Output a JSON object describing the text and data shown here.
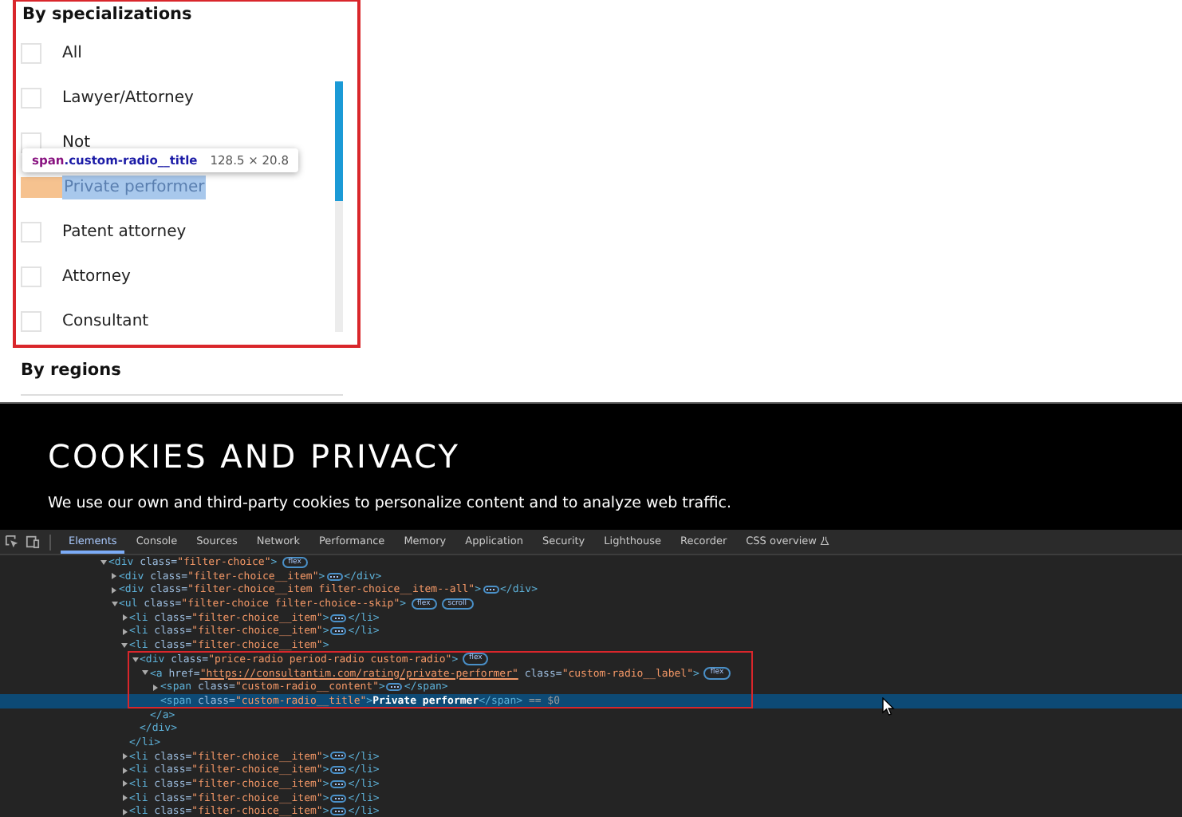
{
  "filter_panel": {
    "title": "By specializations",
    "items": [
      {
        "label": "All",
        "checked": false,
        "inspected": false
      },
      {
        "label": "Lawyer/Attorney",
        "checked": false,
        "inspected": false
      },
      {
        "label": "Not",
        "checked": false,
        "inspected": false
      },
      {
        "label": "Private performer",
        "checked": false,
        "inspected": true
      },
      {
        "label": "Patent attorney",
        "checked": false,
        "inspected": false
      },
      {
        "label": "Attorney",
        "checked": false,
        "inspected": false
      },
      {
        "label": "Consultant",
        "checked": false,
        "inspected": false
      }
    ],
    "inspect_tooltip": {
      "tag": "span",
      "selector": ".custom-radio__title",
      "size": "128.5 × 20.8"
    }
  },
  "regions_heading": "By regions",
  "cookie_banner": {
    "title": "COOKIES AND PRIVACY",
    "text": "We use our own and third-party cookies to personalize content and to analyze web traffic."
  },
  "devtools": {
    "tabs": [
      {
        "label": "Elements",
        "selected": true,
        "experimental": false
      },
      {
        "label": "Console",
        "selected": false,
        "experimental": false
      },
      {
        "label": "Sources",
        "selected": false,
        "experimental": false
      },
      {
        "label": "Network",
        "selected": false,
        "experimental": false
      },
      {
        "label": "Performance",
        "selected": false,
        "experimental": false
      },
      {
        "label": "Memory",
        "selected": false,
        "experimental": false
      },
      {
        "label": "Application",
        "selected": false,
        "experimental": false
      },
      {
        "label": "Security",
        "selected": false,
        "experimental": false
      },
      {
        "label": "Lighthouse",
        "selected": false,
        "experimental": false
      },
      {
        "label": "Recorder",
        "selected": false,
        "experimental": false
      },
      {
        "label": "CSS overview",
        "selected": false,
        "experimental": true
      }
    ],
    "dom_tree": [
      {
        "kind": "collapsible",
        "expanded": true,
        "selected": false,
        "segments": [
          {
            "text": "<div",
            "kind": "tag"
          },
          {
            "text": " class=",
            "kind": "attr"
          },
          {
            "text": "\"filter-choice\"",
            "kind": "value"
          },
          {
            "text": ">",
            "kind": "tag"
          },
          {
            "text": "flex",
            "kind": "badge"
          }
        ],
        "children": [
          {
            "kind": "collapsible",
            "expanded": false,
            "selected": false,
            "segments": [
              {
                "text": "<div",
                "kind": "tag"
              },
              {
                "text": " class=",
                "kind": "attr"
              },
              {
                "text": "\"filter-choice__item\"",
                "kind": "value"
              },
              {
                "text": ">",
                "kind": "tag"
              },
              {
                "kind": "ellipsis"
              },
              {
                "text": "</div>",
                "kind": "tag"
              }
            ]
          },
          {
            "kind": "collapsible",
            "expanded": false,
            "selected": false,
            "segments": [
              {
                "text": "<div",
                "kind": "tag"
              },
              {
                "text": " class=",
                "kind": "attr"
              },
              {
                "text": "\"filter-choice__item filter-choice__item--all\"",
                "kind": "value"
              },
              {
                "text": ">",
                "kind": "tag"
              },
              {
                "kind": "ellipsis"
              },
              {
                "text": "</div>",
                "kind": "tag"
              }
            ]
          },
          {
            "kind": "collapsible",
            "expanded": true,
            "selected": false,
            "segments": [
              {
                "text": "<ul",
                "kind": "tag"
              },
              {
                "text": " class=",
                "kind": "attr"
              },
              {
                "text": "\"filter-choice filter-choice--skip\"",
                "kind": "value"
              },
              {
                "text": ">",
                "kind": "tag"
              },
              {
                "text": "flex",
                "kind": "badge"
              },
              {
                "text": "scroll",
                "kind": "badge"
              }
            ],
            "children": [
              {
                "kind": "collapsible",
                "expanded": false,
                "selected": false,
                "segments": [
                  {
                    "text": "<li",
                    "kind": "tag"
                  },
                  {
                    "text": " class=",
                    "kind": "attr"
                  },
                  {
                    "text": "\"filter-choice__item\"",
                    "kind": "value"
                  },
                  {
                    "text": ">",
                    "kind": "tag"
                  },
                  {
                    "kind": "ellipsis"
                  },
                  {
                    "text": "</li>",
                    "kind": "tag"
                  }
                ]
              },
              {
                "kind": "collapsible",
                "expanded": false,
                "selected": false,
                "segments": [
                  {
                    "text": "<li",
                    "kind": "tag"
                  },
                  {
                    "text": " class=",
                    "kind": "attr"
                  },
                  {
                    "text": "\"filter-choice__item\"",
                    "kind": "value"
                  },
                  {
                    "text": ">",
                    "kind": "tag"
                  },
                  {
                    "kind": "ellipsis"
                  },
                  {
                    "text": "</li>",
                    "kind": "tag"
                  }
                ]
              },
              {
                "kind": "collapsible",
                "expanded": true,
                "selected": false,
                "segments": [
                  {
                    "text": "<li",
                    "kind": "tag"
                  },
                  {
                    "text": " class=",
                    "kind": "attr"
                  },
                  {
                    "text": "\"filter-choice__item\"",
                    "kind": "value"
                  },
                  {
                    "text": ">",
                    "kind": "tag"
                  }
                ],
                "closing": "</li>",
                "children": [
                  {
                    "kind": "collapsible",
                    "expanded": true,
                    "selected": false,
                    "segments": [
                      {
                        "text": "<div",
                        "kind": "tag"
                      },
                      {
                        "text": " class=",
                        "kind": "attr"
                      },
                      {
                        "text": "\"price-radio period-radio custom-radio\"",
                        "kind": "value"
                      },
                      {
                        "text": ">",
                        "kind": "tag"
                      },
                      {
                        "text": "flex",
                        "kind": "badge"
                      }
                    ],
                    "closing": "</div>",
                    "children": [
                      {
                        "kind": "collapsible",
                        "expanded": true,
                        "selected": false,
                        "segments": [
                          {
                            "text": "<a",
                            "kind": "tag"
                          },
                          {
                            "text": " href=",
                            "kind": "attr"
                          },
                          {
                            "text": "\"https://consultantim.com/rating/private-performer\"",
                            "kind": "link"
                          },
                          {
                            "text": " class=",
                            "kind": "attr"
                          },
                          {
                            "text": "\"custom-radio__label\"",
                            "kind": "value"
                          },
                          {
                            "text": ">",
                            "kind": "tag"
                          },
                          {
                            "text": "flex",
                            "kind": "badge"
                          }
                        ],
                        "closing": "</a>",
                        "children": [
                          {
                            "kind": "collapsible",
                            "expanded": false,
                            "selected": false,
                            "segments": [
                              {
                                "text": "<span",
                                "kind": "tag"
                              },
                              {
                                "text": " class=",
                                "kind": "attr"
                              },
                              {
                                "text": "\"custom-radio__content\"",
                                "kind": "value"
                              },
                              {
                                "text": ">",
                                "kind": "tag"
                              },
                              {
                                "kind": "ellipsis"
                              },
                              {
                                "text": "</span>",
                                "kind": "tag"
                              }
                            ]
                          },
                          {
                            "kind": "leaf",
                            "selected": true,
                            "segments": [
                              {
                                "text": "<span",
                                "kind": "tag"
                              },
                              {
                                "text": " class=",
                                "kind": "attr"
                              },
                              {
                                "text": "\"custom-radio__title\"",
                                "kind": "value"
                              },
                              {
                                "text": ">",
                                "kind": "tag"
                              },
                              {
                                "text": "Private performer",
                                "kind": "text"
                              },
                              {
                                "text": "</span>",
                                "kind": "tag"
                              },
                              {
                                "text": " == $0",
                                "kind": "dim"
                              }
                            ]
                          }
                        ]
                      }
                    ]
                  }
                ]
              },
              {
                "kind": "collapsible",
                "expanded": false,
                "selected": false,
                "segments": [
                  {
                    "text": "<li",
                    "kind": "tag"
                  },
                  {
                    "text": " class=",
                    "kind": "attr"
                  },
                  {
                    "text": "\"filter-choice__item\"",
                    "kind": "value"
                  },
                  {
                    "text": ">",
                    "kind": "tag"
                  },
                  {
                    "kind": "ellipsis"
                  },
                  {
                    "text": "</li>",
                    "kind": "tag"
                  }
                ]
              },
              {
                "kind": "collapsible",
                "expanded": false,
                "selected": false,
                "segments": [
                  {
                    "text": "<li",
                    "kind": "tag"
                  },
                  {
                    "text": " class=",
                    "kind": "attr"
                  },
                  {
                    "text": "\"filter-choice__item\"",
                    "kind": "value"
                  },
                  {
                    "text": ">",
                    "kind": "tag"
                  },
                  {
                    "kind": "ellipsis"
                  },
                  {
                    "text": "</li>",
                    "kind": "tag"
                  }
                ]
              },
              {
                "kind": "collapsible",
                "expanded": false,
                "selected": false,
                "segments": [
                  {
                    "text": "<li",
                    "kind": "tag"
                  },
                  {
                    "text": " class=",
                    "kind": "attr"
                  },
                  {
                    "text": "\"filter-choice__item\"",
                    "kind": "value"
                  },
                  {
                    "text": ">",
                    "kind": "tag"
                  },
                  {
                    "kind": "ellipsis"
                  },
                  {
                    "text": "</li>",
                    "kind": "tag"
                  }
                ]
              },
              {
                "kind": "collapsible",
                "expanded": false,
                "selected": false,
                "segments": [
                  {
                    "text": "<li",
                    "kind": "tag"
                  },
                  {
                    "text": " class=",
                    "kind": "attr"
                  },
                  {
                    "text": "\"filter-choice__item\"",
                    "kind": "value"
                  },
                  {
                    "text": ">",
                    "kind": "tag"
                  },
                  {
                    "kind": "ellipsis"
                  },
                  {
                    "text": "</li>",
                    "kind": "tag"
                  }
                ]
              },
              {
                "kind": "collapsible",
                "expanded": false,
                "selected": false,
                "segments": [
                  {
                    "text": "<li",
                    "kind": "tag"
                  },
                  {
                    "text": " class=",
                    "kind": "attr"
                  },
                  {
                    "text": "\"filter-choice__item\"",
                    "kind": "value"
                  },
                  {
                    "text": ">",
                    "kind": "tag"
                  },
                  {
                    "kind": "ellipsis"
                  },
                  {
                    "text": "</li>",
                    "kind": "tag"
                  }
                ]
              }
            ]
          }
        ]
      }
    ]
  }
}
